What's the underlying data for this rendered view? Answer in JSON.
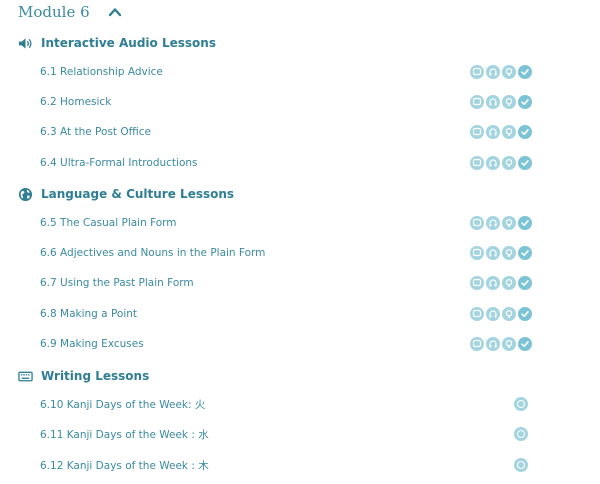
{
  "module": {
    "title": "Module 6"
  },
  "sections": [
    {
      "title": "Interactive Audio Lessons",
      "icon": "speaker-icon",
      "lessons": [
        {
          "label": "6.1 Relationship Advice"
        },
        {
          "label": "6.2 Homesick"
        },
        {
          "label": "6.3 At the Post Office"
        },
        {
          "label": "6.4 Ultra-Formal Introductions"
        }
      ]
    },
    {
      "title": "Language & Culture Lessons",
      "icon": "globe-icon",
      "lessons": [
        {
          "label": "6.5 The Casual Plain Form"
        },
        {
          "label": "6.6 Adjectives and Nouns in the Plain Form"
        },
        {
          "label": "6.7 Using the Past Plain Form"
        },
        {
          "label": "6.8 Making a Point"
        },
        {
          "label": "6.9 Making Excuses"
        }
      ]
    },
    {
      "title": "Writing Lessons",
      "icon": "keyboard-icon",
      "lessons": [
        {
          "label": "6.10 Kanji Days of the Week: 火"
        },
        {
          "label": "6.11 Kanji Days of the Week : 水"
        },
        {
          "label": "6.12 Kanji Days of the Week : 木"
        }
      ]
    }
  ],
  "colors": {
    "accent": "#2f7e94",
    "badge": "#a3d4df",
    "badge_done": "#7cc4d5"
  }
}
